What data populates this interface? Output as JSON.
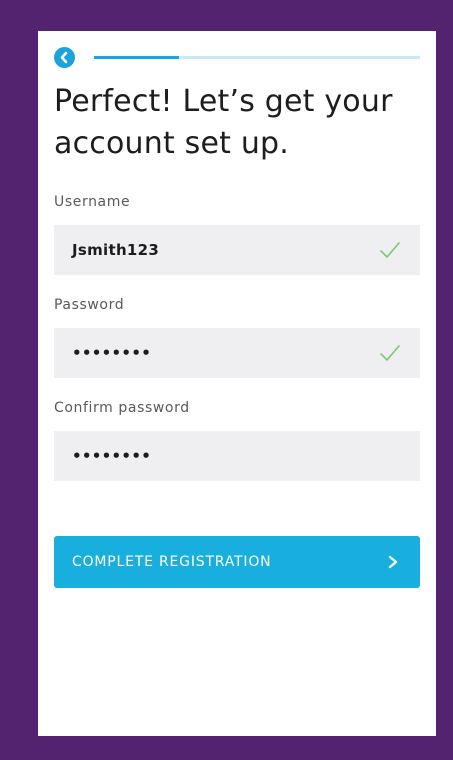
{
  "colors": {
    "frame": "#54236f",
    "accent": "#1aa3dc",
    "progress_track": "#c9e9f7",
    "check": "#7cc96e"
  },
  "header": {
    "back_icon": "chevron-left-icon",
    "progress_fraction": 0.26
  },
  "title": "Perfect! Let’s get your account set up.",
  "form": {
    "username": {
      "label": "Username",
      "value": "Jsmith123",
      "valid": true,
      "icon": "check-icon"
    },
    "password": {
      "label": "Password",
      "value": "••••••••",
      "valid": true,
      "icon": "check-icon"
    },
    "confirm_password": {
      "label": "Confirm password",
      "value": "••••••••",
      "valid": false
    }
  },
  "cta": {
    "label": "COMPLETE REGISTRATION",
    "icon": "chevron-right-icon"
  }
}
